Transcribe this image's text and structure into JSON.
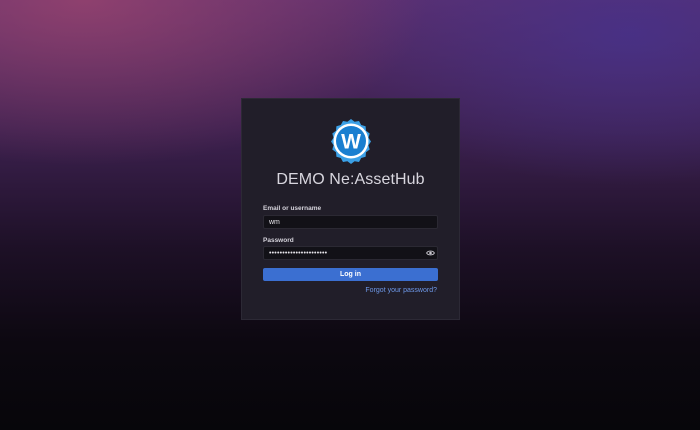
{
  "app": {
    "title": "DEMO Ne:AssetHub",
    "logo_letter": "W",
    "logo_icon": "w-badge-logo"
  },
  "form": {
    "email_label": "Email or username",
    "email_value": "wm",
    "password_label": "Password",
    "password_value": "••••••••••••••••••••••",
    "password_toggle_icon": "eye-icon",
    "login_label": "Log in",
    "forgot_password_label": "Forgot your password?"
  },
  "colors": {
    "accent": "#3b6fd1",
    "link": "#6e98e8",
    "card_background": "#211e29",
    "logo_blue": "#1a7fd0"
  }
}
